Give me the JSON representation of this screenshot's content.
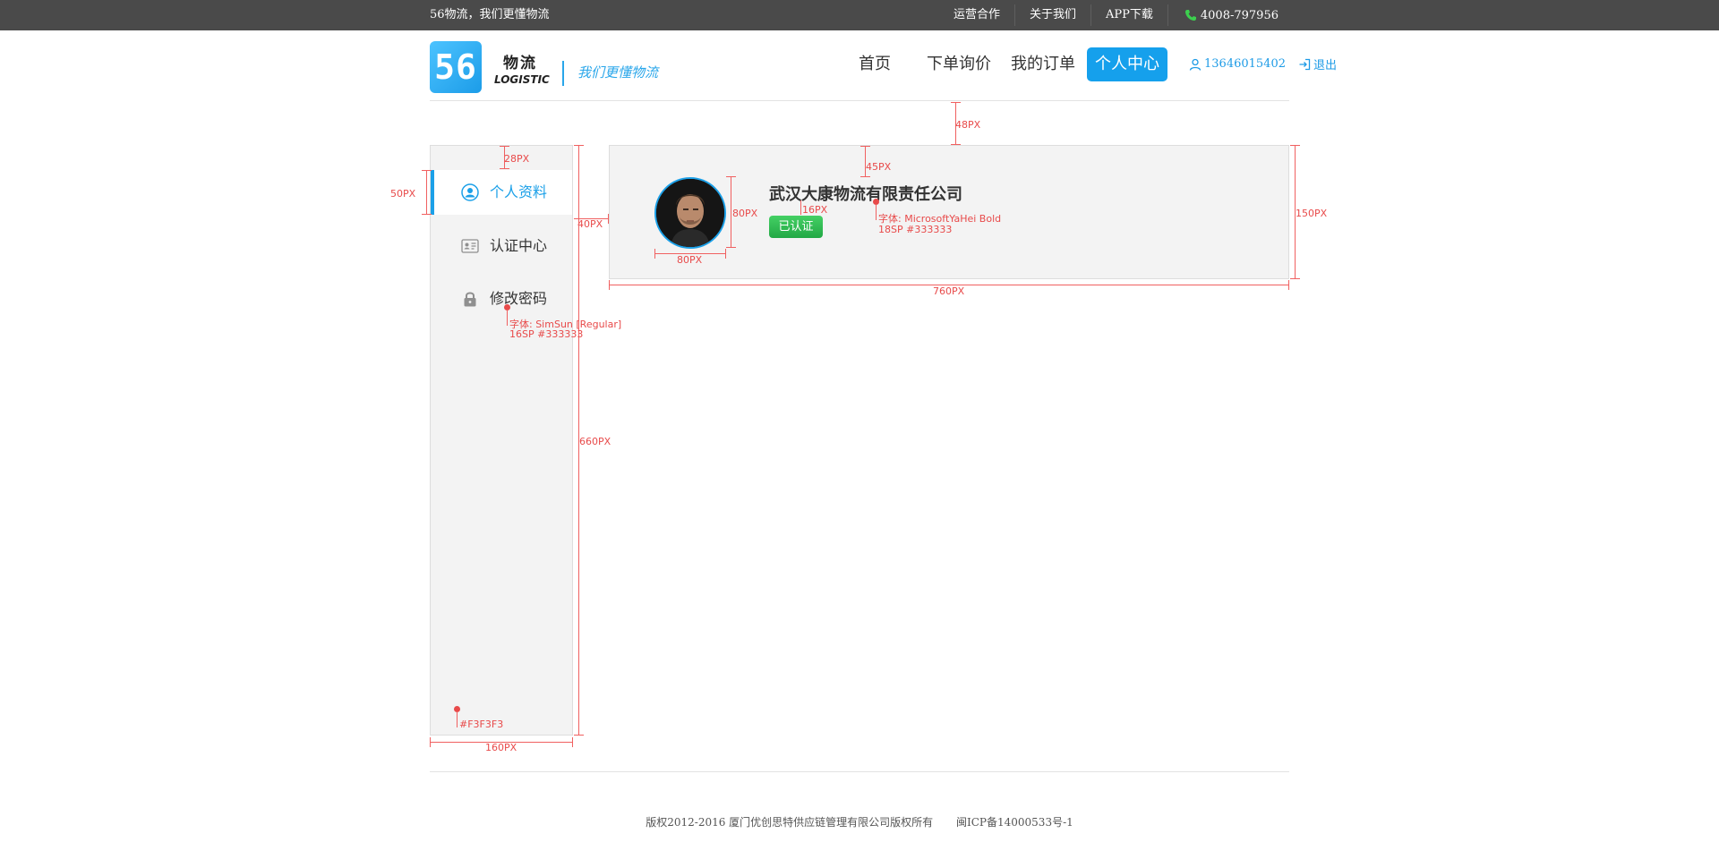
{
  "topbar": {
    "slogan": "56物流，我们更懂物流",
    "links": [
      "运营合作",
      "关于我们",
      "APP下载"
    ],
    "phone": "4008-797956"
  },
  "header": {
    "logo_mark": "56",
    "logo_cn": "物流",
    "logo_en": "LOGISTIC",
    "logo_slogan": "我们更懂物流",
    "nav": [
      "首页",
      "下单询价",
      "我的订单",
      "个人中心"
    ],
    "nav_active": "个人中心",
    "user_phone": "13646015402",
    "logout": "退出"
  },
  "sidebar": {
    "items": [
      {
        "label": "个人资料",
        "icon": "user-circle-icon",
        "active": true
      },
      {
        "label": "认证中心",
        "icon": "id-card-icon",
        "active": false
      },
      {
        "label": "修改密码",
        "icon": "lock-icon",
        "active": false
      }
    ]
  },
  "profile": {
    "company": "武汉大康物流有限责任公司",
    "badge": "已认证"
  },
  "annotations": {
    "top_gap": "48PX",
    "side_top": "28PX",
    "item_h": "50PX",
    "gap_40": "40PX",
    "side_h": "660PX",
    "side_w": "160PX",
    "side_bg": "#F3F3F3",
    "side_font_1": "字体: SimSun [Regular]",
    "side_font_2": "16SP #333333",
    "card_top": "45PX",
    "avatar_h": "80PX",
    "avatar_w": "80PX",
    "gap_16": "16PX",
    "title_font_1": "字体: MicrosoftYaHei Bold",
    "title_font_2": "18SP #333333",
    "card_h": "150PX",
    "card_w": "760PX"
  },
  "footer": {
    "copyright": "版权2012-2016  厦门优创思特供应链管理有限公司版权所有",
    "icp": "闽ICP备14000533号-1"
  },
  "colors": {
    "accent": "#1BA0E8",
    "badge": "#2DBA4E",
    "annotation": "#E84A4A",
    "panel": "#F3F3F3"
  }
}
